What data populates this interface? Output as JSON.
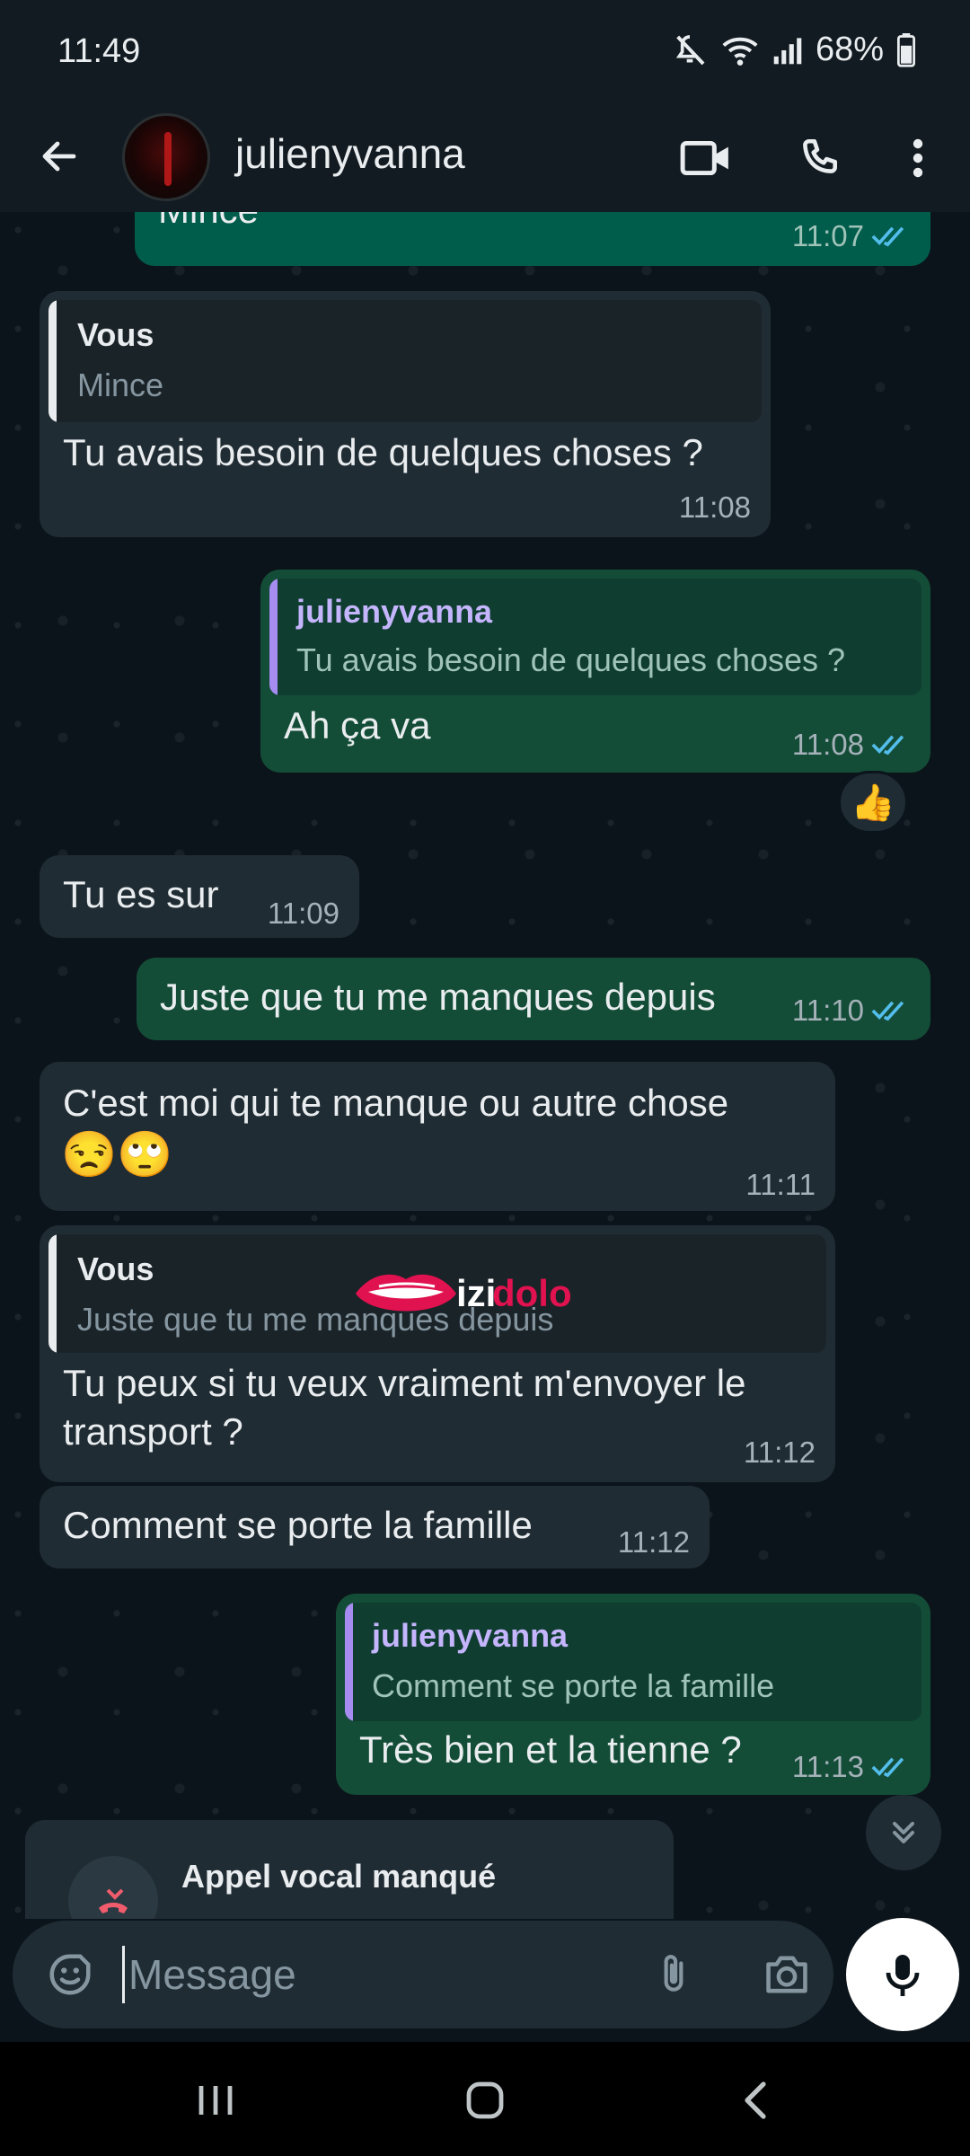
{
  "status_bar": {
    "time": "11:49",
    "battery": "68%"
  },
  "header": {
    "contact_name": "julienyvanna"
  },
  "messages": {
    "m1": {
      "text": "Mince",
      "time": "11:07"
    },
    "m2": {
      "quote_author": "Vous",
      "quote_text": "Mince",
      "text": "Tu avais besoin de quelques choses ?",
      "time": "11:08"
    },
    "m3": {
      "quote_author": "julienyvanna",
      "quote_text": "Tu avais besoin de quelques choses ?",
      "text": "Ah ça va",
      "time": "11:08",
      "reaction": "👍"
    },
    "m4": {
      "text": "Tu es sur",
      "time": "11:09"
    },
    "m5": {
      "text": "Juste que tu me manques depuis",
      "time": "11:10"
    },
    "m6": {
      "text": "C'est moi qui te manque ou autre chose",
      "emojis": "😒🙄",
      "time": "11:11"
    },
    "m7": {
      "quote_author": "Vous",
      "quote_text": "Juste que tu me manques depuis",
      "text_line1": "Tu peux si tu veux vraiment m'envoyer le",
      "text_line2": "transport ?",
      "time": "11:12"
    },
    "m8": {
      "text": "Comment se porte la famille",
      "time": "11:12"
    },
    "m9": {
      "quote_author": "julienyvanna",
      "quote_text": "Comment se porte la famille",
      "text": "Très bien et la tienne ?",
      "time": "11:13"
    },
    "m10": {
      "text": "Appel vocal manqué"
    }
  },
  "watermark": {
    "text_a": "izi",
    "text_b": "dolo"
  },
  "composer": {
    "placeholder": "Message"
  },
  "colors": {
    "accent_blue": "#53bdeb",
    "out_bubble": "#005c4b",
    "in_bubble": "#1f2c34",
    "quote_purple": "#a68cf0",
    "missed_call_red": "#f15c6d"
  }
}
